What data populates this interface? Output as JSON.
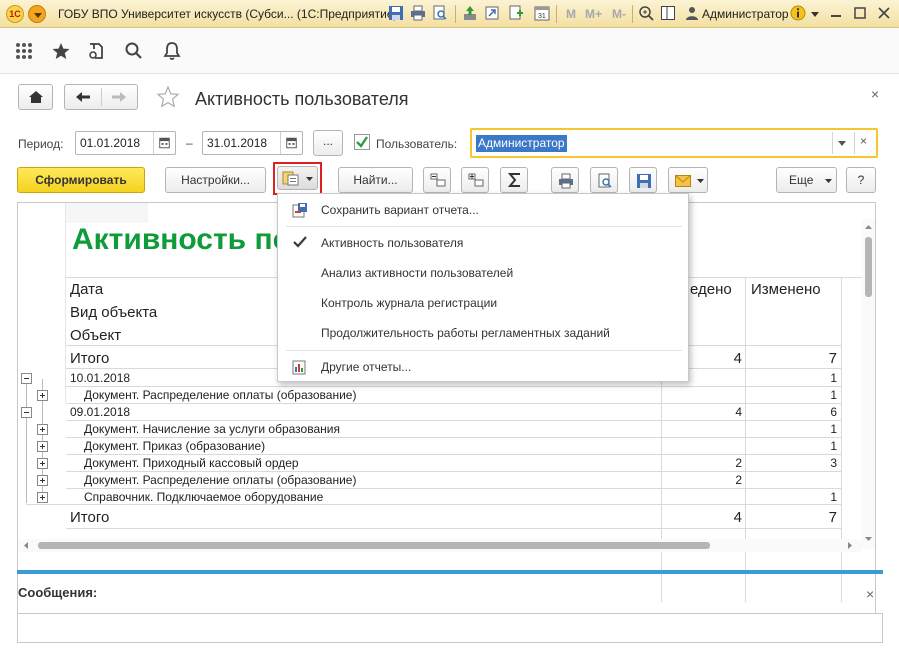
{
  "titlebar": {
    "title": "ГОБУ ВПО Университет искусств (Субси...  (1С:Предприятие)",
    "logo": "1С",
    "m_buttons": [
      "M",
      "M+",
      "M-"
    ],
    "user": "Администратор"
  },
  "form": {
    "title": "Активность пользователя",
    "period_label": "Период:",
    "date_from": "01.01.2018",
    "date_dash": "–",
    "date_to": "31.01.2018",
    "ellipsis": "...",
    "user_label": "Пользователь:",
    "user_value": "Администратор",
    "clear_glyph": "×"
  },
  "toolbar": {
    "generate": "Сформировать",
    "settings": "Настройки...",
    "find": "Найти...",
    "more": "Еще",
    "help": "?"
  },
  "report": {
    "title": "Активность по",
    "headers": {
      "date": "Дата",
      "object_type": "Вид объекта",
      "object": "Объект",
      "entered_partial": "едено",
      "changed": "Изменено"
    },
    "total_label": "Итого",
    "total_top": {
      "entered": "4",
      "changed": "7"
    },
    "rows": [
      {
        "label": "10.01.2018",
        "level": 0,
        "toggle": "minus",
        "entered": "",
        "changed": "1"
      },
      {
        "label": "Документ. Распределение оплаты (образование)",
        "level": 1,
        "toggle": "plus",
        "entered": "",
        "changed": "1"
      },
      {
        "label": "09.01.2018",
        "level": 0,
        "toggle": "minus",
        "entered": "4",
        "changed": "6"
      },
      {
        "label": "Документ. Начисление за услуги образования",
        "level": 1,
        "toggle": "plus",
        "entered": "",
        "changed": "1"
      },
      {
        "label": "Документ. Приказ (образование)",
        "level": 1,
        "toggle": "plus",
        "entered": "",
        "changed": "1"
      },
      {
        "label": "Документ. Приходный кассовый ордер",
        "level": 1,
        "toggle": "plus",
        "entered": "2",
        "changed": "3"
      },
      {
        "label": "Документ. Распределение оплаты (образование)",
        "level": 1,
        "toggle": "plus",
        "entered": "2",
        "changed": ""
      },
      {
        "label": "Справочник. Подключаемое оборудование",
        "level": 1,
        "toggle": "plus",
        "entered": "",
        "changed": "1"
      }
    ],
    "total_bottom": {
      "entered": "4",
      "changed": "7"
    }
  },
  "popup": {
    "save_variant": "Сохранить вариант отчета...",
    "items": [
      {
        "label": "Активность пользователя",
        "checked": true
      },
      {
        "label": "Анализ активности пользователей",
        "checked": false
      },
      {
        "label": "Контроль журнала регистрации",
        "checked": false
      },
      {
        "label": "Продолжительность работы регламентных заданий",
        "checked": false
      }
    ],
    "other_reports": "Другие отчеты..."
  },
  "messages": {
    "title": "Сообщения:"
  },
  "colors": {
    "accent_yellow": "#f4d21e",
    "report_title_green": "#0e9b3a",
    "selection_blue": "#3c78c8",
    "message_line": "#3d9ad8",
    "highlight_red": "#e02020"
  }
}
